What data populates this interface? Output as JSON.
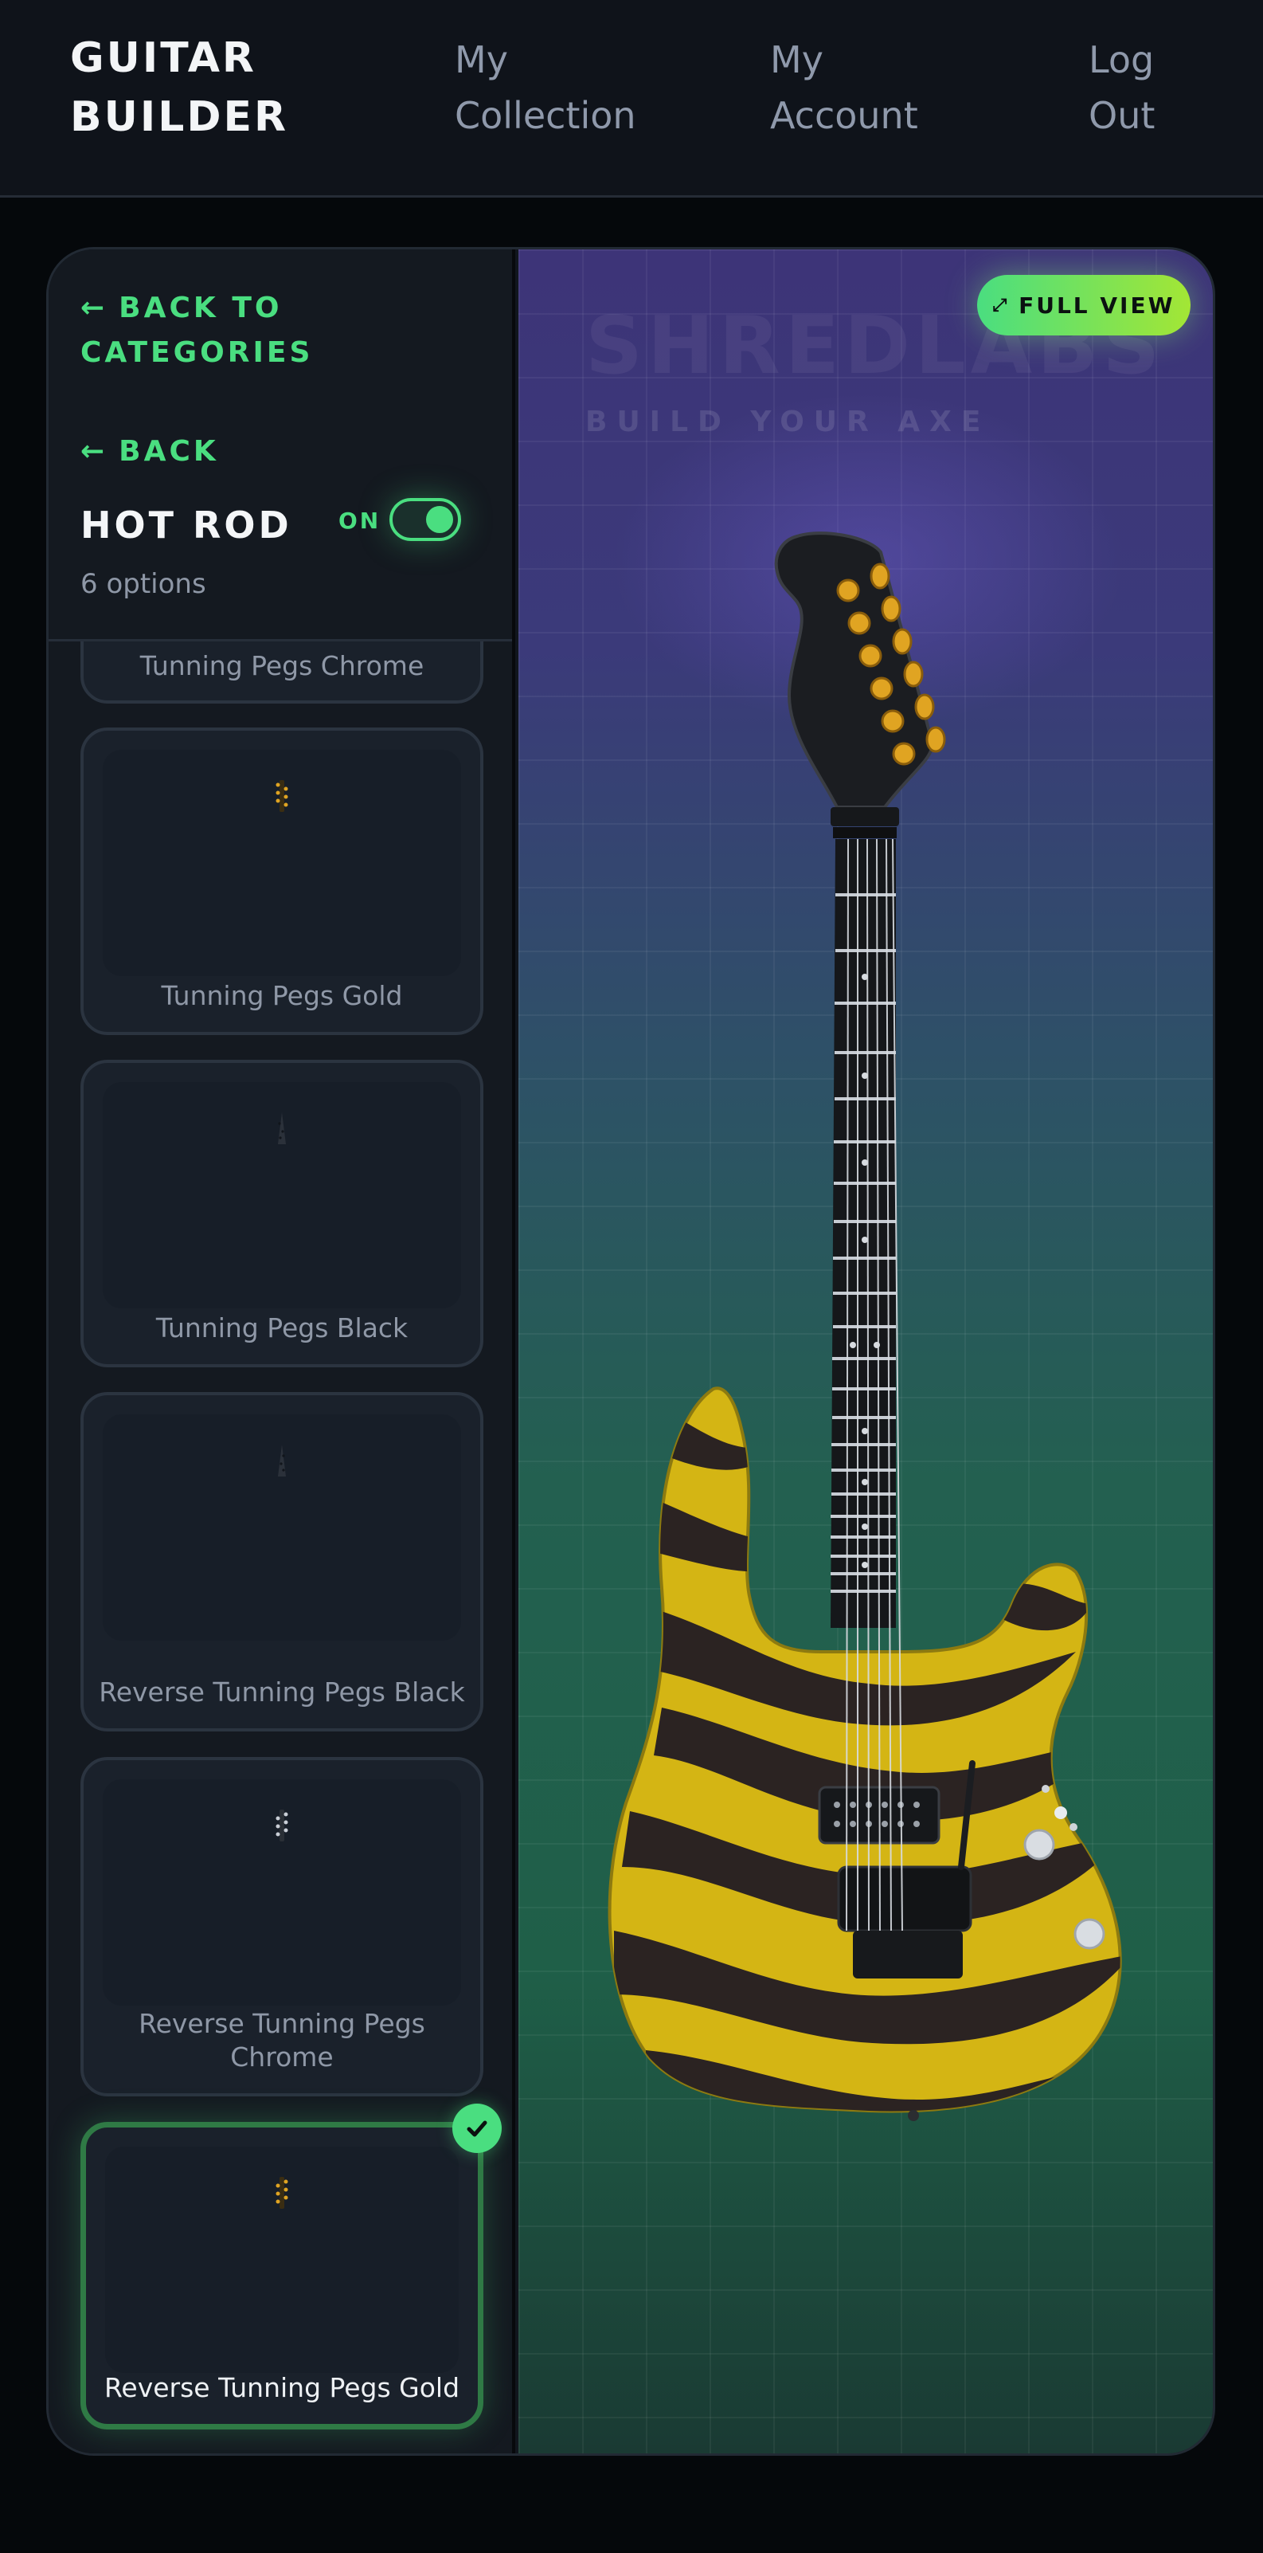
{
  "header": {
    "brand_line1": "GUITAR",
    "brand_line2": "BUILDER",
    "nav": [
      {
        "line1": "My",
        "line2": "Collection"
      },
      {
        "line1": "My",
        "line2": "Account"
      },
      {
        "line1": "Log",
        "line2": "Out"
      }
    ]
  },
  "sidebar": {
    "back_to_categories_line1": "BACK TO",
    "back_to_categories_line2": "CATEGORIES",
    "back_label": "BACK",
    "arrow_glyph": "←",
    "category_title": "HOT ROD",
    "toggle_label": "ON",
    "toggle_on": true,
    "option_count": "6 options",
    "options": [
      {
        "label": "Tunning Pegs Chrome",
        "selected": false,
        "thumb": "chrome-pegs"
      },
      {
        "label": "Tunning Pegs Gold",
        "selected": false,
        "thumb": "gold-pegs"
      },
      {
        "label": "Tunning Pegs Black",
        "selected": false,
        "thumb": "black-pegs"
      },
      {
        "label": "Reverse Tunning Pegs Black",
        "selected": false,
        "thumb": "reverse-black-pegs"
      },
      {
        "label": "Reverse Tunning Pegs Chrome",
        "selected": false,
        "thumb": "reverse-chrome-pegs"
      },
      {
        "label": "Reverse Tunning Pegs Gold",
        "selected": true,
        "thumb": "reverse-gold-pegs"
      }
    ]
  },
  "stage": {
    "watermark": "SHREDLABS",
    "tagline": "BUILD YOUR AXE",
    "full_view_label": "FULL VIEW",
    "full_view_icon": "expand-icon",
    "guitar_finish": "yellow-black tiger stripe",
    "peg_color": "gold"
  },
  "colors": {
    "accent": "#4ade80",
    "accent_lime": "#a3e635",
    "body_yellow": "#d4b514",
    "stripe_dark": "#2b2322",
    "peg_gold": "#e0a422"
  }
}
